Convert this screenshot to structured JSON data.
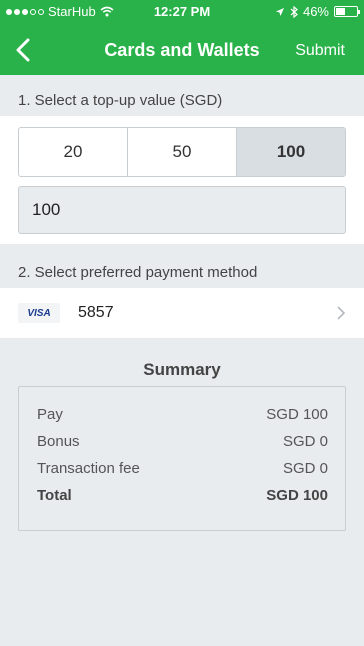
{
  "status_bar": {
    "carrier": "StarHub",
    "time": "12:27 PM",
    "battery": "46%",
    "battery_level": 0.46
  },
  "nav": {
    "title": "Cards and Wallets",
    "submit_label": "Submit"
  },
  "topup": {
    "label": "1. Select a top-up value (SGD)",
    "options": [
      "20",
      "50",
      "100"
    ],
    "selected": "100",
    "input_value": "100"
  },
  "payment": {
    "label": "2. Select preferred payment method",
    "card_brand": "VISA",
    "card_last4": "5857"
  },
  "summary": {
    "title": "Summary",
    "rows": [
      {
        "label": "Pay",
        "value": "SGD 100"
      },
      {
        "label": "Bonus",
        "value": "SGD 0"
      },
      {
        "label": "Transaction fee",
        "value": "SGD 0"
      }
    ],
    "total": {
      "label": "Total",
      "value": "SGD 100"
    }
  },
  "colors": {
    "header": "#2ab24a",
    "background": "#e8ecef",
    "selected_segment": "#d9dee2"
  }
}
